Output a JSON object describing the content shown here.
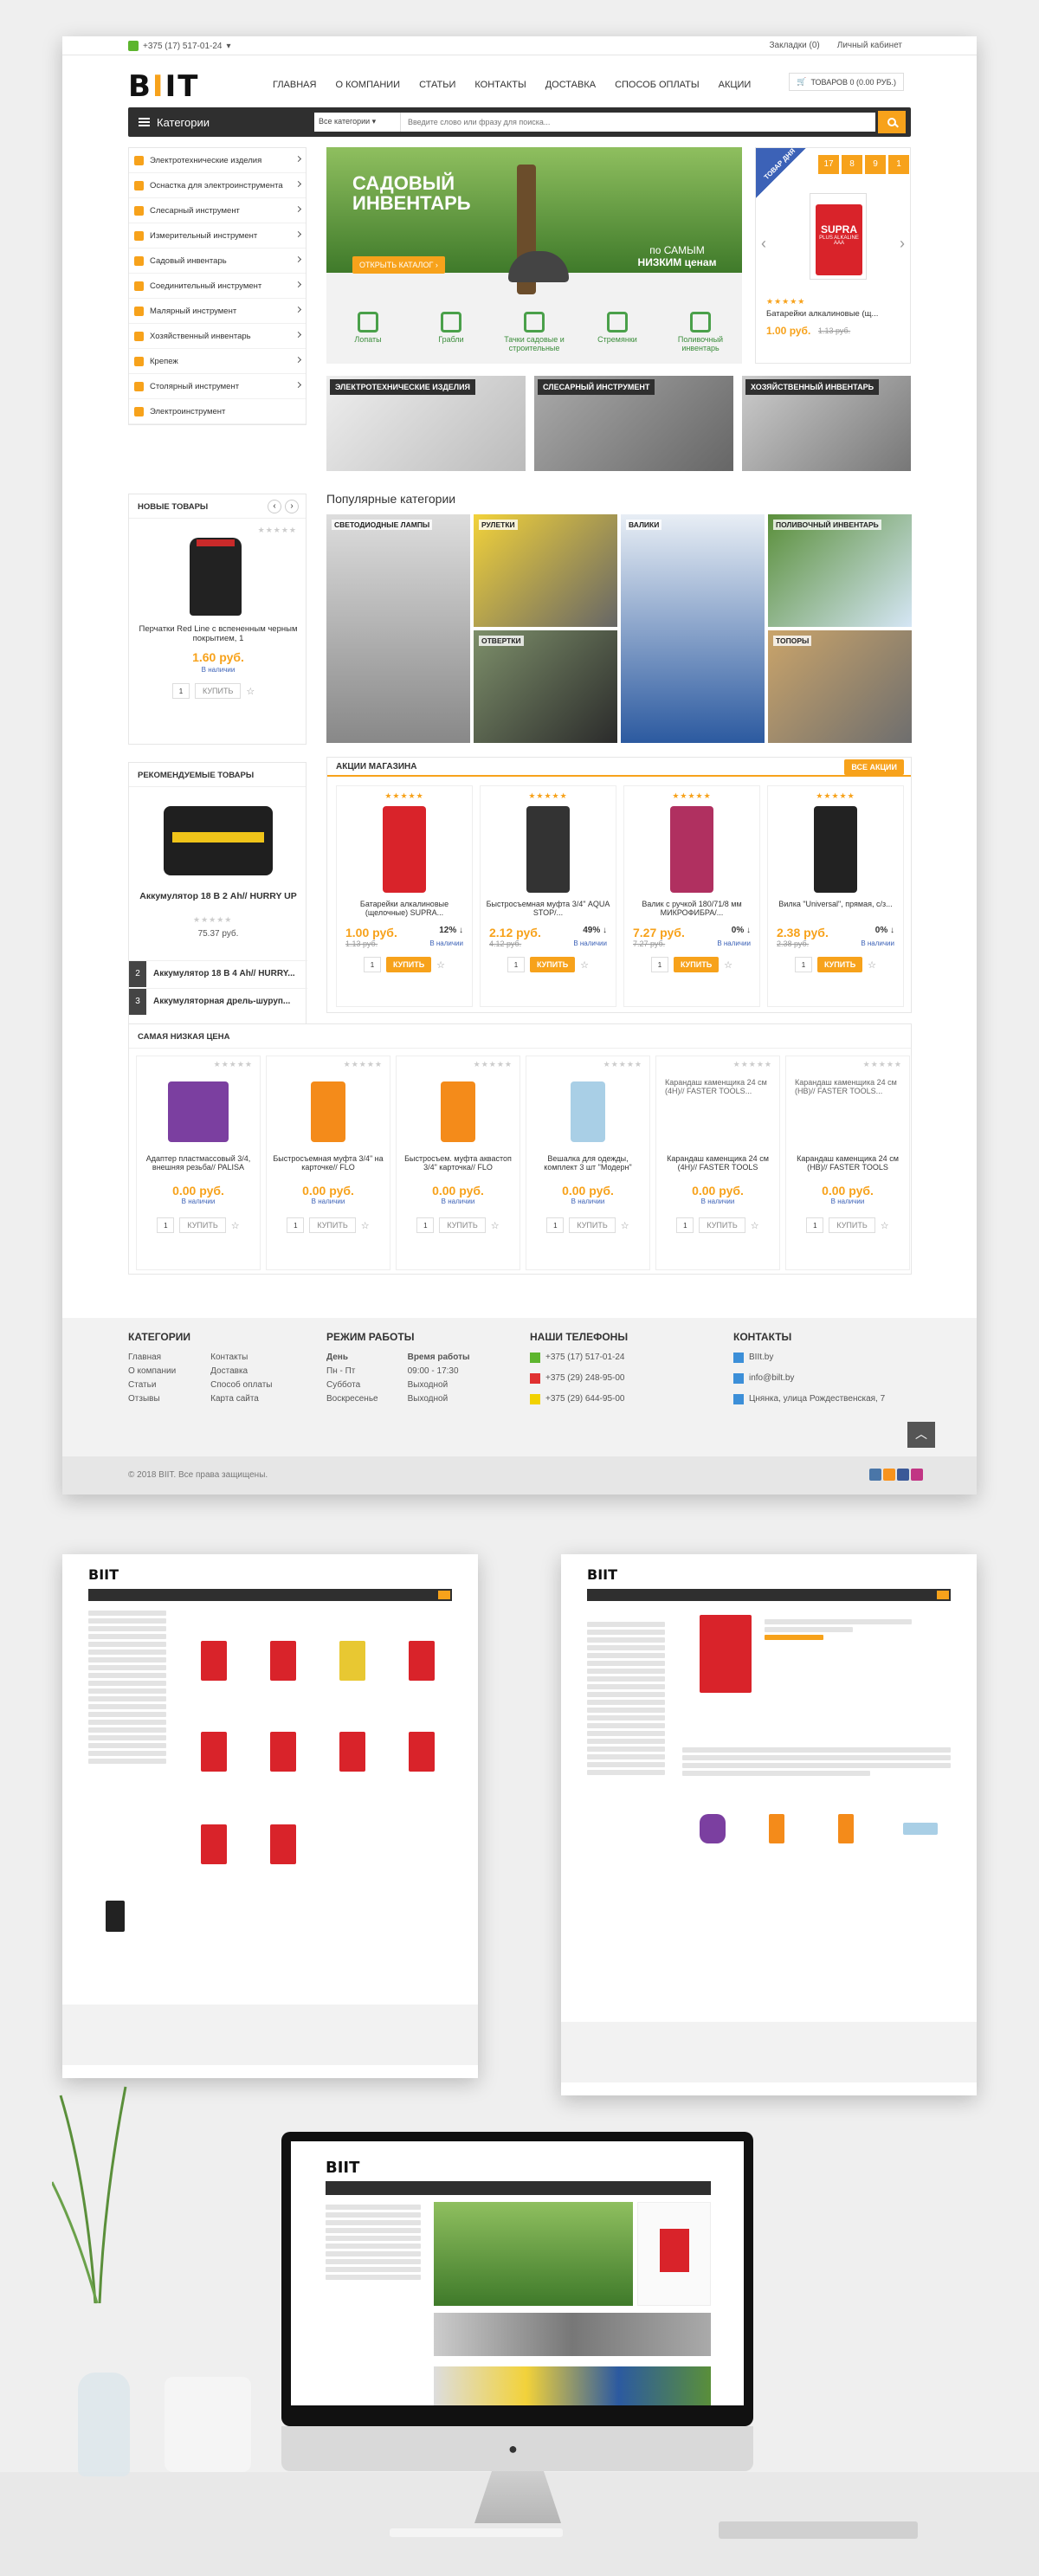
{
  "top": {
    "phone": "+375 (17) 517-01-24",
    "bookmarks": "Закладки (0)",
    "account": "Личный кабинет"
  },
  "logo": {
    "text": "BIIT"
  },
  "nav": [
    "ГЛАВНАЯ",
    "О КОМПАНИИ",
    "СТАТЬИ",
    "КОНТАКТЫ",
    "ДОСТАВКА",
    "СПОСОБ ОПЛАТЫ",
    "АКЦИИ"
  ],
  "cart": {
    "label": "ТОВАРОВ 0 (0.00 РУБ.)"
  },
  "catbar": {
    "label": "Категории",
    "select": "Все категории",
    "placeholder": "Введите слово или фразу для поиска..."
  },
  "categories": [
    "Электротехнические изделия",
    "Оснастка для электроинструмента",
    "Слесарный инструмент",
    "Измерительный инструмент",
    "Садовый инвентарь",
    "Соединительный инструмент",
    "Малярный инструмент",
    "Хозяйственный инвентарь",
    "Крепеж",
    "Столярный инструмент",
    "Электроинструмент"
  ],
  "slider": {
    "title1": "САДОВЫЙ",
    "title2": "ИНВЕНТАРЬ",
    "button": "ОТКРЫТЬ КАТАЛОГ",
    "tag1": "по САМЫМ",
    "tag2": "НИЗКИМ ценам",
    "tools": [
      "Лопаты",
      "Грабли",
      "Тачки садовые и строительные",
      "Стремянки",
      "Поливочный инвентарь"
    ]
  },
  "promo": {
    "ribbon": "ТОВАР ДНЯ",
    "timer": [
      "17",
      "8",
      "9",
      "1"
    ],
    "name": "Батарейки алкалиновые (щ...",
    "price": "1.00 руб.",
    "old": "1.13 руб.",
    "brand": "SUPRA",
    "sub": "PLUS ALKALINE AAA"
  },
  "banners": [
    "ЭЛЕКТРОТЕХНИЧЕСКИЕ ИЗДЕЛИЯ",
    "СЛЕСАРНЫЙ ИНСТРУМЕНТ",
    "ХОЗЯЙСТВЕННЫЙ ИНВЕНТАРЬ"
  ],
  "popular": {
    "title": "Популярные категории",
    "items": [
      "СВЕТОДИОДНЫЕ ЛАМПЫ",
      "РУЛЕТКИ",
      "ВАЛИКИ",
      "ПОЛИВОЧНЫЙ ИНВЕНТАРЬ",
      "ОТВЕРТКИ",
      "ТОПОРЫ"
    ]
  },
  "newgoods": {
    "title": "НОВЫЕ ТОВАРЫ",
    "name": "Перчатки Red Line с вспененным черным покрытием, 1",
    "price": "1.60 руб.",
    "stock": "В наличии",
    "qty": "1",
    "buy": "КУПИТЬ"
  },
  "recommended": {
    "title": "РЕКОМЕНДУЕМЫЕ ТОВАРЫ",
    "name": "Аккумулятор 18 В 2 Ah// HURRY UP",
    "price": "75.37 руб.",
    "list": [
      {
        "n": "2",
        "t": "Аккумулятор 18 В 4 Ah// HURRY..."
      },
      {
        "n": "3",
        "t": "Аккумуляторная дрель-шуруп..."
      }
    ]
  },
  "actions": {
    "title": "АКЦИИ МАГАЗИНА",
    "all": "ВСЕ АКЦИИ",
    "items": [
      {
        "name": "Батарейки алкалиновые (щелочные) SUPRA...",
        "price": "1.00 руб.",
        "old": "1.13 руб.",
        "pct": "12%",
        "stock": "В наличии"
      },
      {
        "name": "Быстросъемная муфта 3/4\" AQUA STOP/...",
        "price": "2.12 руб.",
        "old": "4.12 руб.",
        "pct": "49%",
        "stock": "В наличии"
      },
      {
        "name": "Валик с ручкой 180/71/8 мм МИКРОФИБРА/...",
        "price": "7.27 руб.",
        "old": "7.27 руб.",
        "pct": "0%",
        "stock": "В наличии"
      },
      {
        "name": "Вилка \"Universal\", прямая, с/з...",
        "price": "2.38 руб.",
        "old": "2.38 руб.",
        "pct": "0%",
        "stock": "В наличии"
      }
    ],
    "qty": "1",
    "buy": "КУПИТЬ"
  },
  "lowest": {
    "title": "САМАЯ НИЗКАЯ ЦЕНА",
    "items": [
      {
        "name": "Адаптер пластмассовый 3/4, внешняя резьба// PALISA",
        "price": "0.00 руб.",
        "stock": "В наличии"
      },
      {
        "name": "Быстросъемная муфта 3/4\" на карточке// FLO",
        "price": "0.00 руб.",
        "stock": "В наличии"
      },
      {
        "name": "Быстросъем. муфта аквастоп 3/4\" карточка// FLO",
        "price": "0.00 руб.",
        "stock": "В наличии"
      },
      {
        "name": "Вешалка для одежды, комплект 3 шт \"Модерн\"",
        "price": "0.00 руб.",
        "stock": "В наличии"
      },
      {
        "name": "Карандаш каменщика 24 см (4H)// FASTER TOOLS",
        "price": "0.00 руб.",
        "stock": "В наличии",
        "alt": "Карандаш каменщика 24 см (4H)// FASTER TOOLS..."
      },
      {
        "name": "Карандаш каменщика 24 см (HB)// FASTER TOOLS",
        "price": "0.00 руб.",
        "stock": "В наличии",
        "alt": "Карандаш каменщика 24 см (HB)// FASTER TOOLS..."
      }
    ],
    "qty": "1",
    "buy": "КУПИТЬ"
  },
  "footer": {
    "cats_title": "КАТЕГОРИИ",
    "cats1": [
      "Главная",
      "О компании",
      "Статьи",
      "Отзывы"
    ],
    "cats2": [
      "Контакты",
      "Доставка",
      "Способ оплаты",
      "Карта сайта"
    ],
    "mode_title": "РЕЖИМ РАБОТЫ",
    "day": "День",
    "time": "Время работы",
    "days": [
      "Пн - Пт",
      "Суббота",
      "Воскресенье"
    ],
    "times": [
      "09:00 - 17:30",
      "Выходной",
      "Выходной"
    ],
    "phones_title": "НАШИ ТЕЛЕФОНЫ",
    "phones": [
      "+375 (17) 517-01-24",
      "+375 (29) 248-95-00",
      "+375 (29) 644-95-00"
    ],
    "contacts_title": "КОНТАКТЫ",
    "contacts": [
      "BIIt.by",
      "info@bilt.by",
      "Цнянка, улица Рождественская, 7"
    ],
    "copyright": "© 2018 BIIT. Все права защищены."
  },
  "colors": {
    "accent": "#f7a21b",
    "dark": "#2f2f2f",
    "green": "#5db52e",
    "blue": "#3c62b7"
  }
}
